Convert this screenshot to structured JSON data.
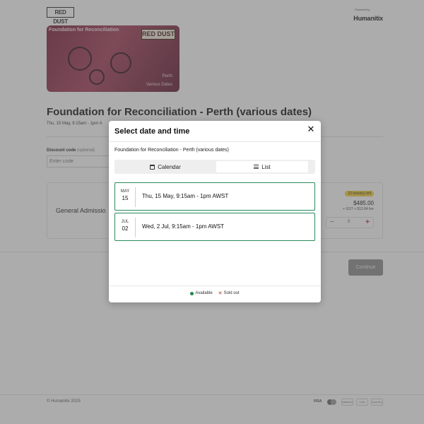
{
  "header": {
    "brand_logo": "RED DUST",
    "powered_by": "Powered by",
    "platform": "Humanitix"
  },
  "event_image": {
    "title": "Foundation for Reconciliation",
    "logo": "RED DUST",
    "city": "Perth",
    "dates": "Various Dates"
  },
  "event": {
    "title": "Foundation for Reconciliation - Perth (various dates)",
    "date_line": "Thu, 15 May, 9:15am - 1pm A"
  },
  "discount": {
    "label": "Discount code",
    "optional": "(optional)",
    "placeholder": "Enter code"
  },
  "ticket": {
    "name": "General Admissio",
    "tickets_left": "10 ticket(s) left",
    "price": "$485.00",
    "fee": "+ GST + $13.84 fee",
    "minus": "−",
    "quantity": "0",
    "plus": "+"
  },
  "continue_label": "Continue",
  "footer": {
    "copyright": "© Humanitix 2025",
    "payments": [
      "VISA",
      "",
      "AMERICAN EXPRESS",
      "G Pay",
      "Apple Pay"
    ]
  },
  "modal": {
    "title": "Select date and time",
    "close": "✕",
    "event_name": "Foundation for Reconciliation - Perth (various dates)",
    "tabs": {
      "calendar": "Calendar",
      "list": "List"
    },
    "dates": [
      {
        "month": "MAY",
        "day": "15",
        "label": "Thu, 15 May, 9:15am - 1pm AWST"
      },
      {
        "month": "JUL",
        "day": "02",
        "label": "Wed, 2 Jul, 9:15am - 1pm AWST"
      }
    ],
    "legend": {
      "available": "Available",
      "sold_out": "Sold out"
    }
  },
  "colors": {
    "available": "#1f8a4c",
    "sold_out": "#c12a2a",
    "date_border": "#2b8a5c",
    "brand": "#7a1d3a"
  }
}
